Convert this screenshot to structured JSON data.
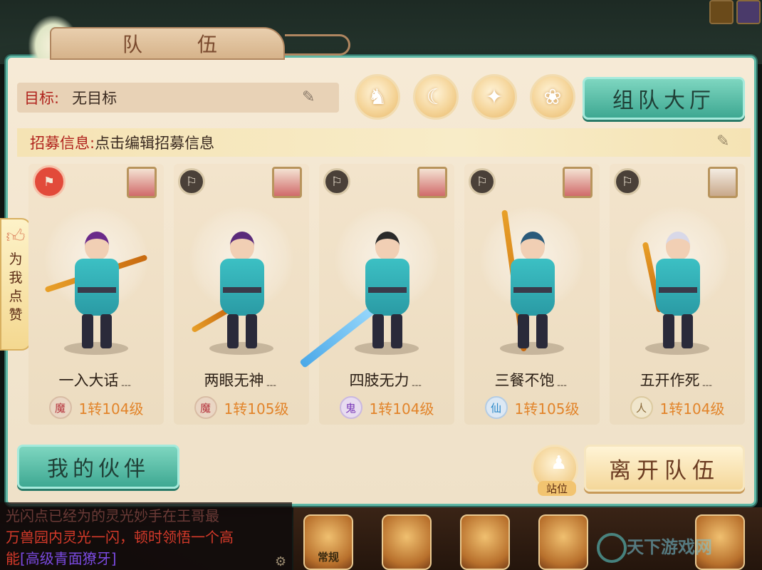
{
  "panel": {
    "title": "队 伍",
    "target": {
      "key": "目标:",
      "value": "无目标"
    },
    "recruit": {
      "key": "招募信息:",
      "value": "点击编辑招募信息"
    },
    "lobby_button": "组队大厅",
    "partner_button": "我的伙伴",
    "leave_button": "离开队伍",
    "stance_label": "站位"
  },
  "like_tab": {
    "chars": [
      "为",
      "我",
      "点",
      "赞"
    ]
  },
  "members": [
    {
      "name": "一入大话﹍",
      "race": "魔",
      "level": "1转104级",
      "leader": true
    },
    {
      "name": "两眼无神﹍",
      "race": "魔",
      "level": "1转105级",
      "leader": false
    },
    {
      "name": "四肢无力﹍",
      "race": "鬼",
      "level": "1转104级",
      "leader": false
    },
    {
      "name": "三餐不饱﹍",
      "race": "仙",
      "level": "1转105级",
      "leader": false
    },
    {
      "name": "五开作死﹍",
      "race": "人",
      "level": "1转104级",
      "leader": false
    }
  ],
  "chat": {
    "line1": "光闪点已经为的灵光妙手在王哥最",
    "line2": "万兽园内灵光一闪，顿时领悟一个高",
    "line3_prefix": "能",
    "line3_link": "[高级青面獠牙]"
  },
  "dock": {
    "item1": "常规"
  },
  "watermark": "天下游戏网",
  "icons": {
    "mode": [
      "horse-icon",
      "moon-icon",
      "fox-icon",
      "bird-icon"
    ],
    "flag": "flag-icon",
    "pen": "pen-icon",
    "thumb": "thumbs-up-icon"
  },
  "colors": {
    "accent_teal": "#3ea892",
    "label_red": "#b0221c",
    "level_orange": "#e2842a"
  }
}
